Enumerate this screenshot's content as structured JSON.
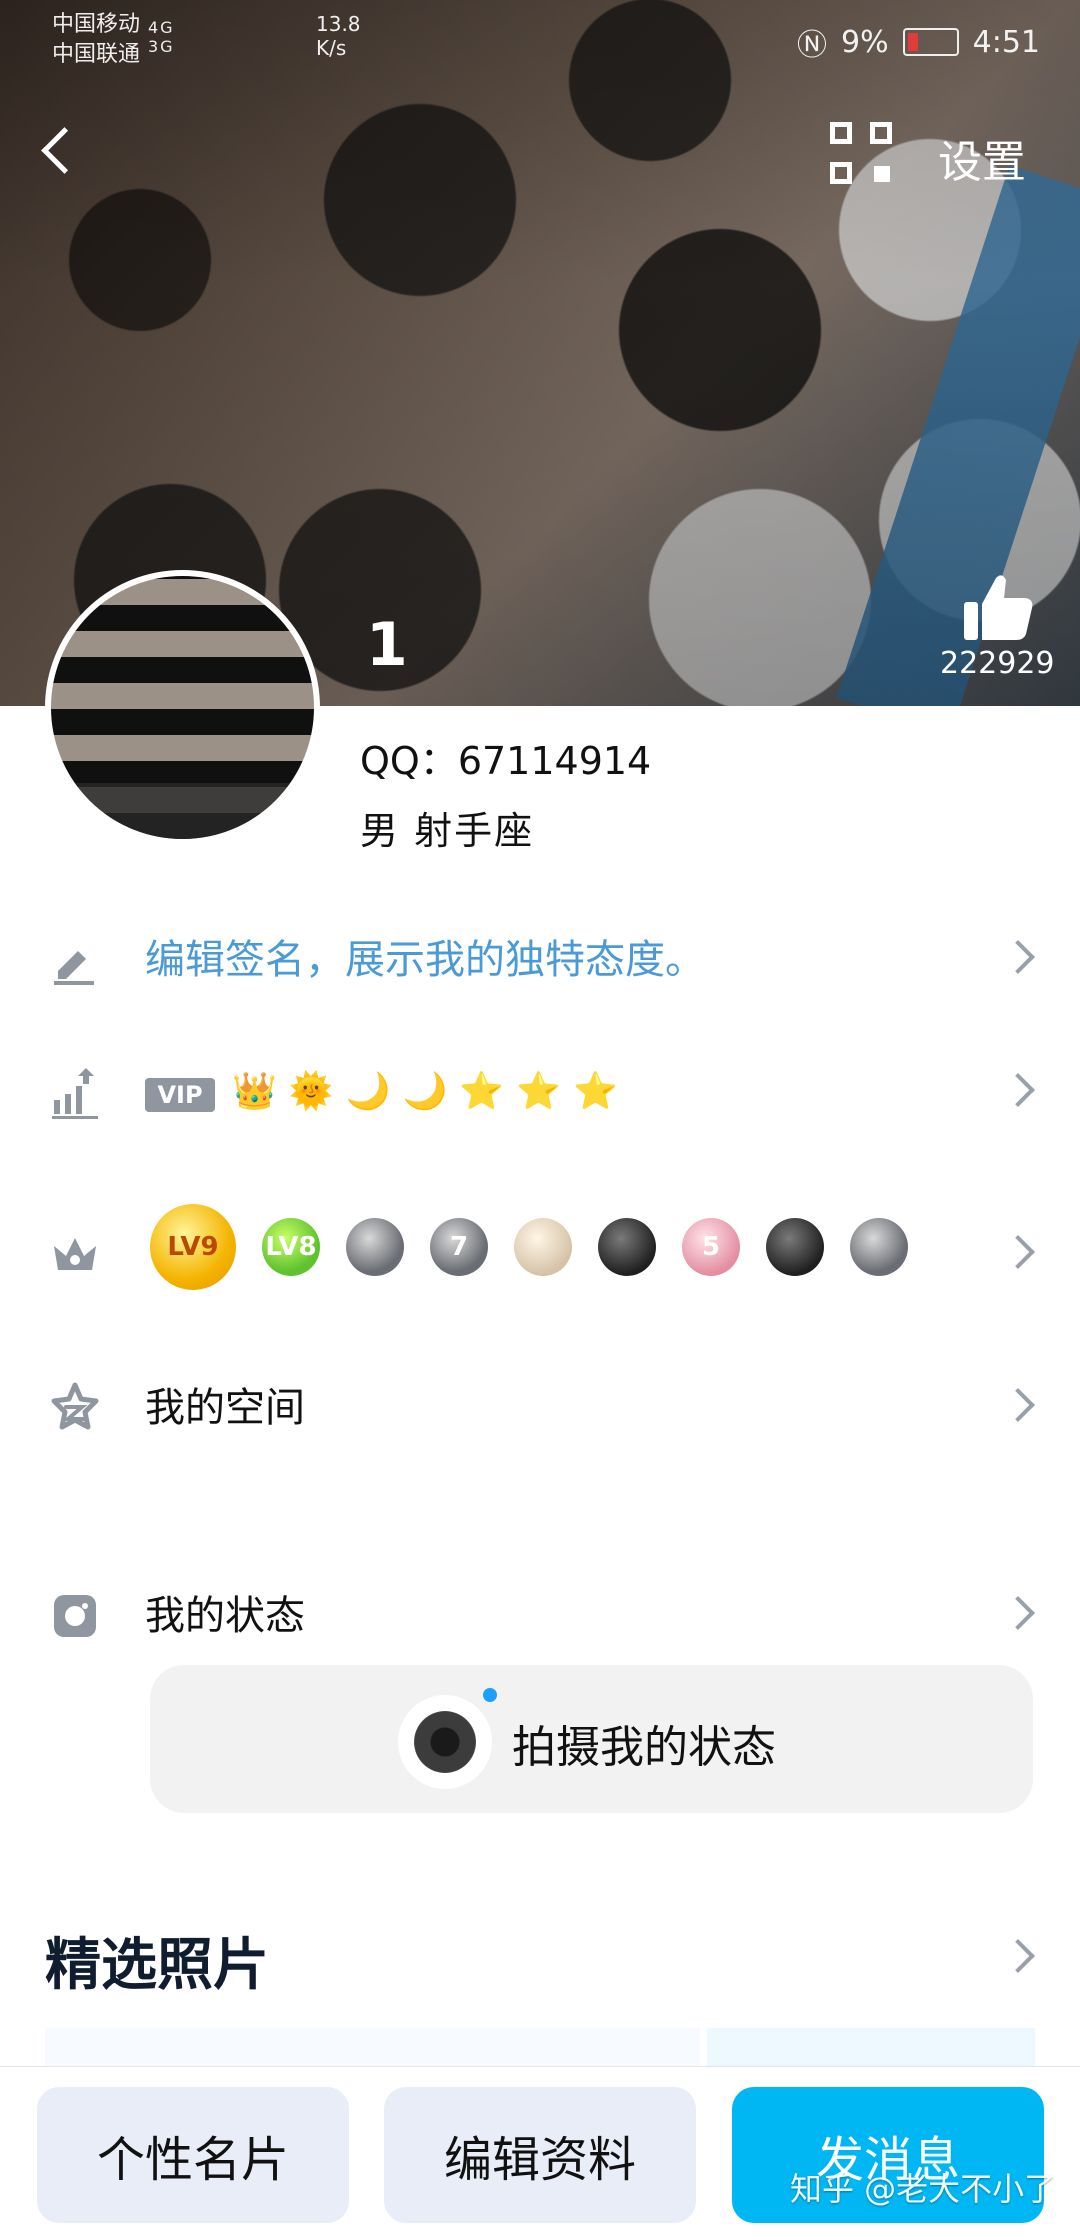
{
  "status_bar": {
    "carrier_1": "中国移动",
    "carrier_2": "中国联通",
    "network_1": "4G",
    "network_2": "3G",
    "speed_value": "13.8",
    "speed_unit": "K/s",
    "battery_percent": "9%",
    "time": "4:51",
    "nfc_icon": "nfc-icon",
    "battery_icon": "battery-icon"
  },
  "top_nav": {
    "back_icon": "chevron-left-icon",
    "qr_icon": "qr-code-icon",
    "settings_label": "设置"
  },
  "profile": {
    "avatar_badge": "1",
    "qq_text": "QQ：67114914",
    "gender_sign": "男  射手座",
    "like_count": "222929"
  },
  "rows": [
    {
      "label": "编辑签名，展示我的独特态度。",
      "icon": "pencil-icon"
    },
    {
      "label": "VIP",
      "icon": "bar-chart-up-icon"
    },
    {
      "label": "",
      "icon": "crown-icon"
    },
    {
      "label": "我的空间",
      "icon": "star-icon"
    },
    {
      "label": "我的状态",
      "icon": "camera-icon"
    }
  ],
  "vip": {
    "emojis": [
      "👑",
      "🌞",
      "🌙",
      "🌙",
      "⭐",
      "⭐",
      "⭐"
    ]
  },
  "badges": [
    {
      "text": "LV9"
    },
    {
      "text": "LV8"
    },
    {
      "text": ""
    },
    {
      "text": "7"
    },
    {
      "text": ""
    },
    {
      "text": ""
    },
    {
      "text": "5"
    },
    {
      "text": ""
    },
    {
      "text": ""
    }
  ],
  "status_card": {
    "label": "拍摄我的状态",
    "icon": "camera-shutter-icon"
  },
  "photos": {
    "title": "精选照片",
    "chevron_icon": "chevron-right-icon"
  },
  "bottom_bar": {
    "left_button": "个性名片",
    "middle_button": "编辑资料",
    "right_button": "发消息"
  },
  "watermark": "知乎 @老大不小了"
}
